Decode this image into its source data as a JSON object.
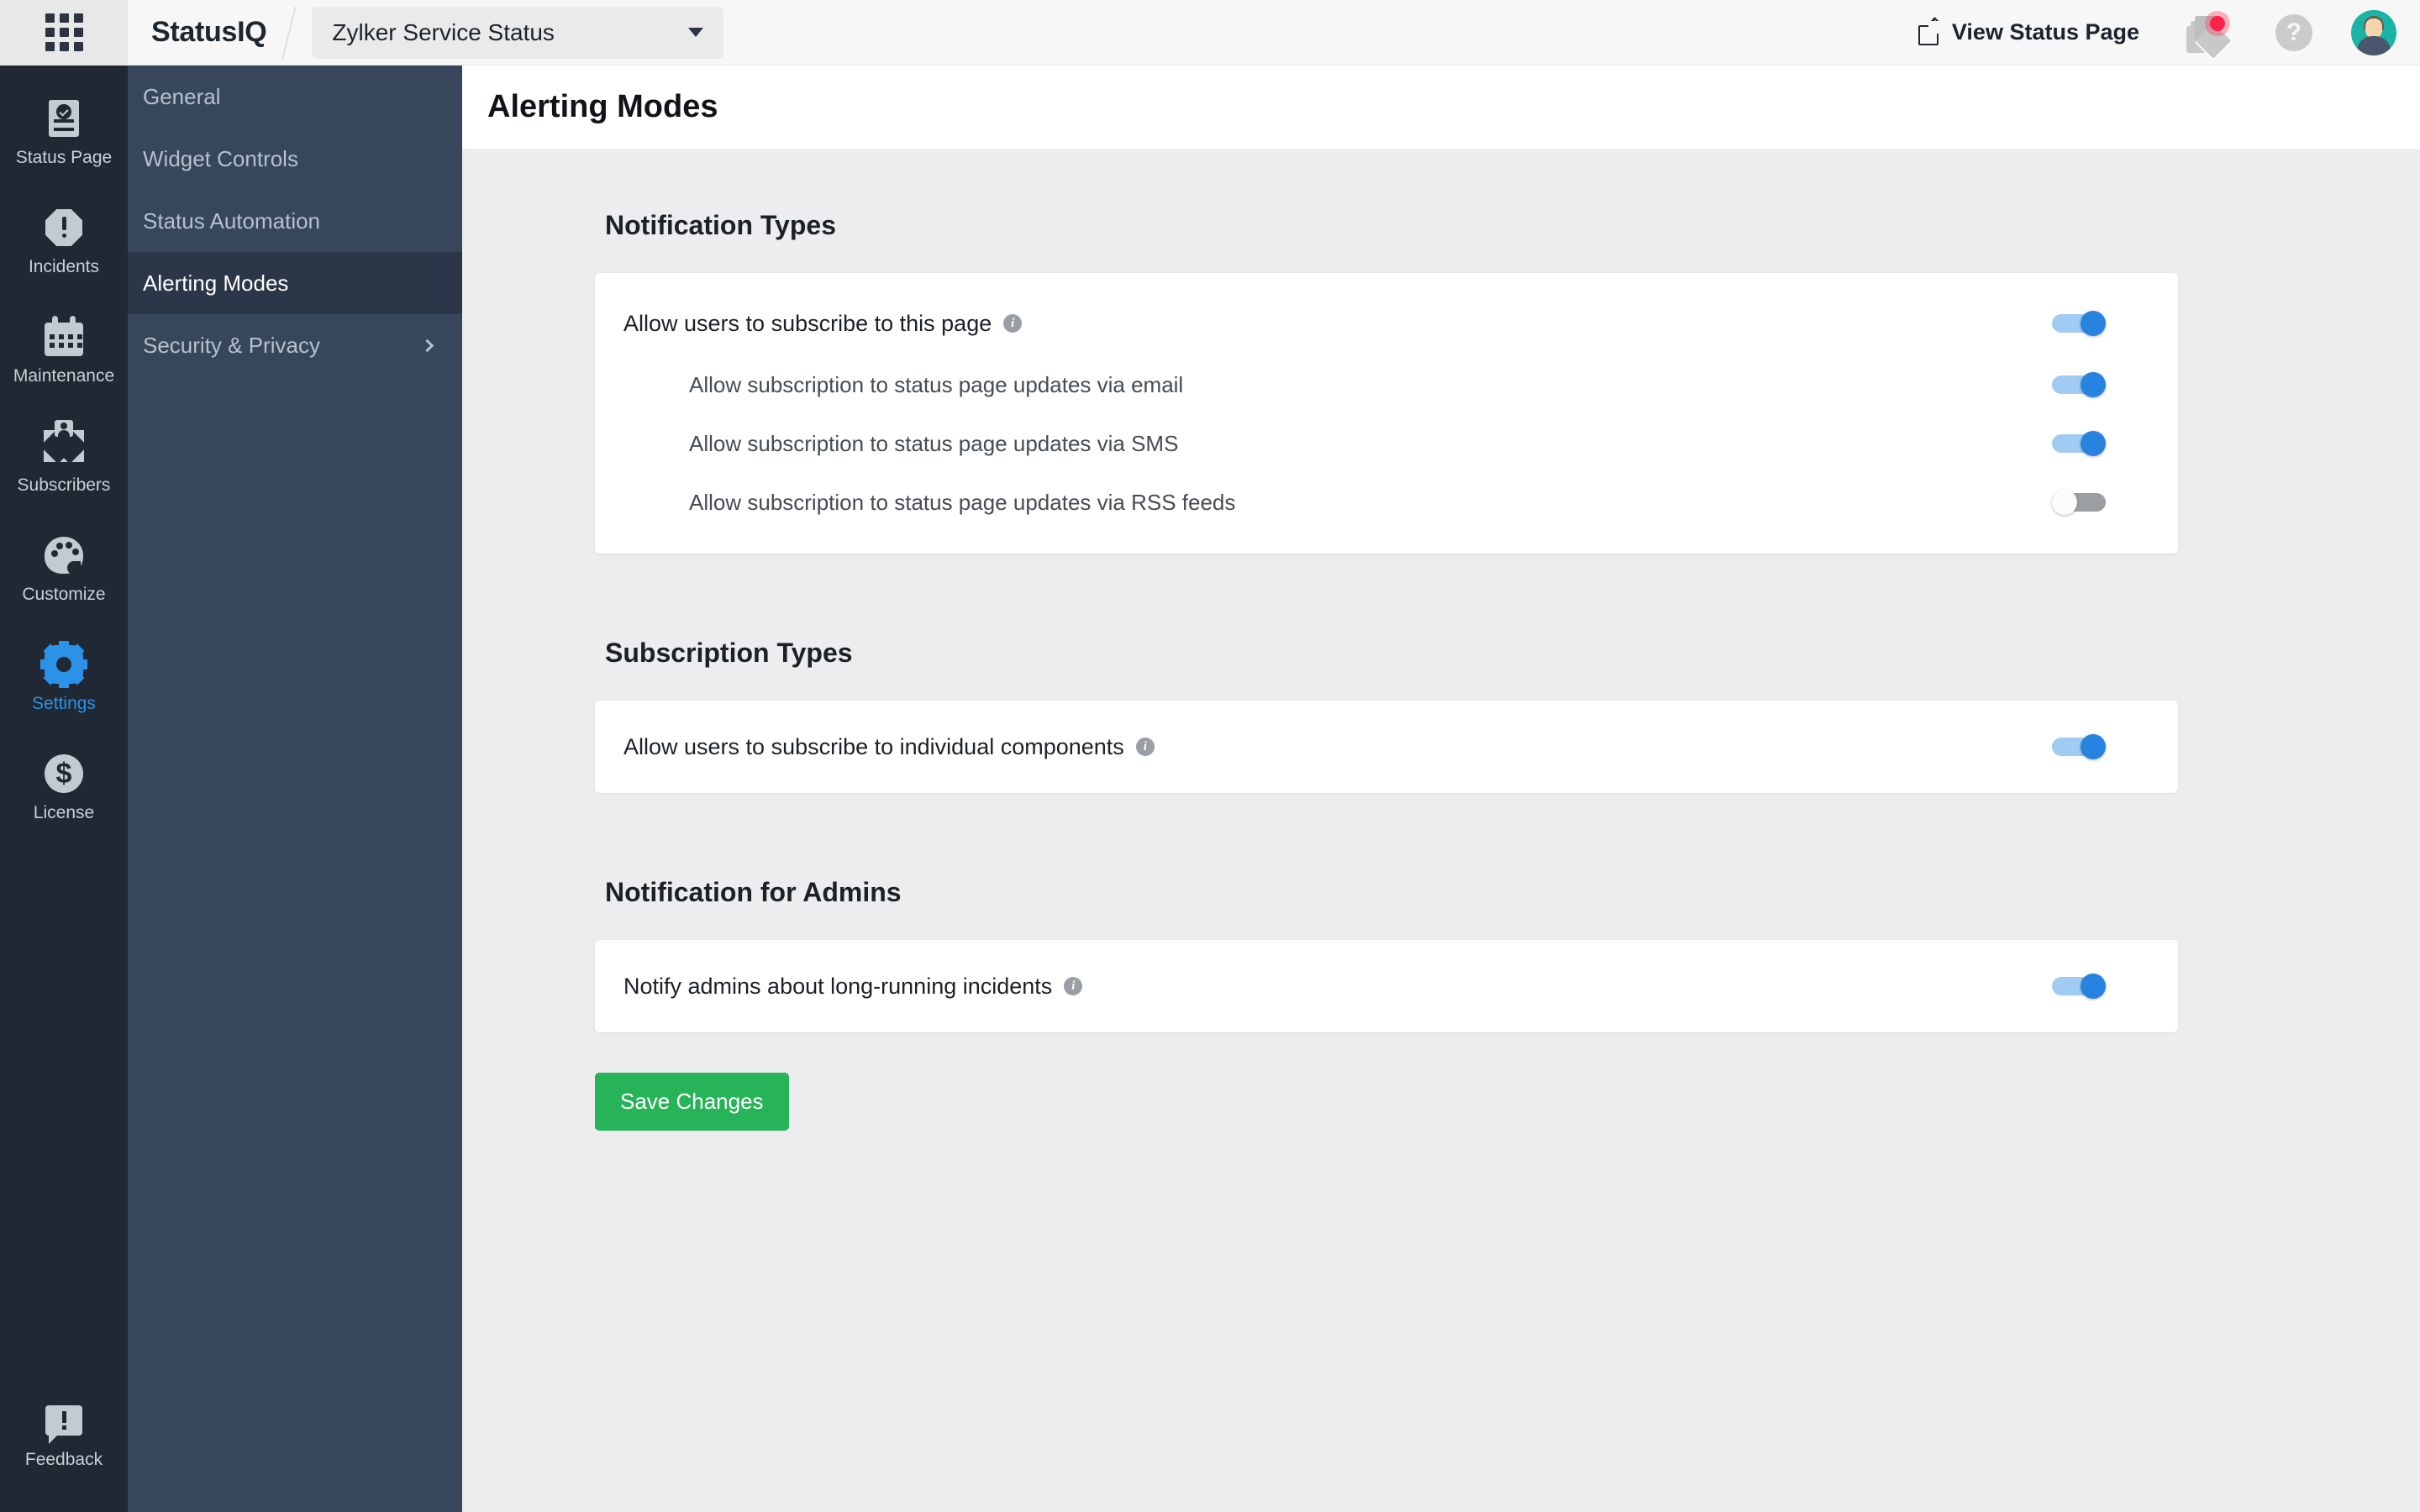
{
  "header": {
    "apps_icon": "grid-apps-icon",
    "brand": "StatusIQ",
    "project_name": "Zylker Service Status",
    "view_status_page": "View Status Page",
    "external_link_icon": "external-link-icon",
    "announcements_icon": "announcements-cards-icon",
    "has_notification_dot": true,
    "help_label": "?",
    "avatar_icon": "user-avatar"
  },
  "rail": {
    "items": [
      {
        "label": "Status Page",
        "icon": "document-check-icon",
        "active": false
      },
      {
        "label": "Incidents",
        "icon": "alert-octagon-icon",
        "active": false
      },
      {
        "label": "Maintenance",
        "icon": "calendar-icon",
        "active": false
      },
      {
        "label": "Subscribers",
        "icon": "envelope-user-icon",
        "active": false
      },
      {
        "label": "Customize",
        "icon": "palette-icon",
        "active": false
      },
      {
        "label": "Settings",
        "icon": "gear-icon",
        "active": true
      },
      {
        "label": "License",
        "icon": "dollar-circle-icon",
        "active": false
      }
    ],
    "bottom": {
      "label": "Feedback",
      "icon": "feedback-bubble-icon"
    }
  },
  "subnav": {
    "items": [
      {
        "label": "General",
        "active": false,
        "has_chevron": false
      },
      {
        "label": "Widget Controls",
        "active": false,
        "has_chevron": false
      },
      {
        "label": "Status Automation",
        "active": false,
        "has_chevron": false
      },
      {
        "label": "Alerting Modes",
        "active": true,
        "has_chevron": false
      },
      {
        "label": "Security & Privacy",
        "active": false,
        "has_chevron": true
      }
    ]
  },
  "page": {
    "title": "Alerting Modes",
    "sections": [
      {
        "title": "Notification Types",
        "rows": [
          {
            "label": "Allow users to subscribe to this page",
            "info": true,
            "sub": false,
            "toggle": "on"
          },
          {
            "label": "Allow subscription to status page updates via email",
            "info": false,
            "sub": true,
            "toggle": "on"
          },
          {
            "label": "Allow subscription to status page updates via SMS",
            "info": false,
            "sub": true,
            "toggle": "on"
          },
          {
            "label": "Allow subscription to status page updates via RSS feeds",
            "info": false,
            "sub": true,
            "toggle": "off"
          }
        ]
      },
      {
        "title": "Subscription Types",
        "rows": [
          {
            "label": "Allow users to subscribe to individual components",
            "info": true,
            "sub": false,
            "toggle": "on"
          }
        ]
      },
      {
        "title": "Notification for Admins",
        "rows": [
          {
            "label": "Notify admins about long-running incidents",
            "info": true,
            "sub": false,
            "toggle": "on"
          }
        ]
      }
    ],
    "save_label": "Save Changes"
  },
  "colors": {
    "accent_blue": "#2c92e8",
    "toggle_on_knob": "#2684e0",
    "toggle_on_track": "#a0cbf2",
    "toggle_off_track": "#9b9ea2",
    "save_green": "#27b357",
    "rail_bg": "#1f2833",
    "subnav_bg": "#37465a",
    "subnav_active_bg": "#2b3749",
    "content_bg": "#ededef",
    "notification_red": "#f8254b",
    "avatar_teal": "#1ab3a6"
  }
}
